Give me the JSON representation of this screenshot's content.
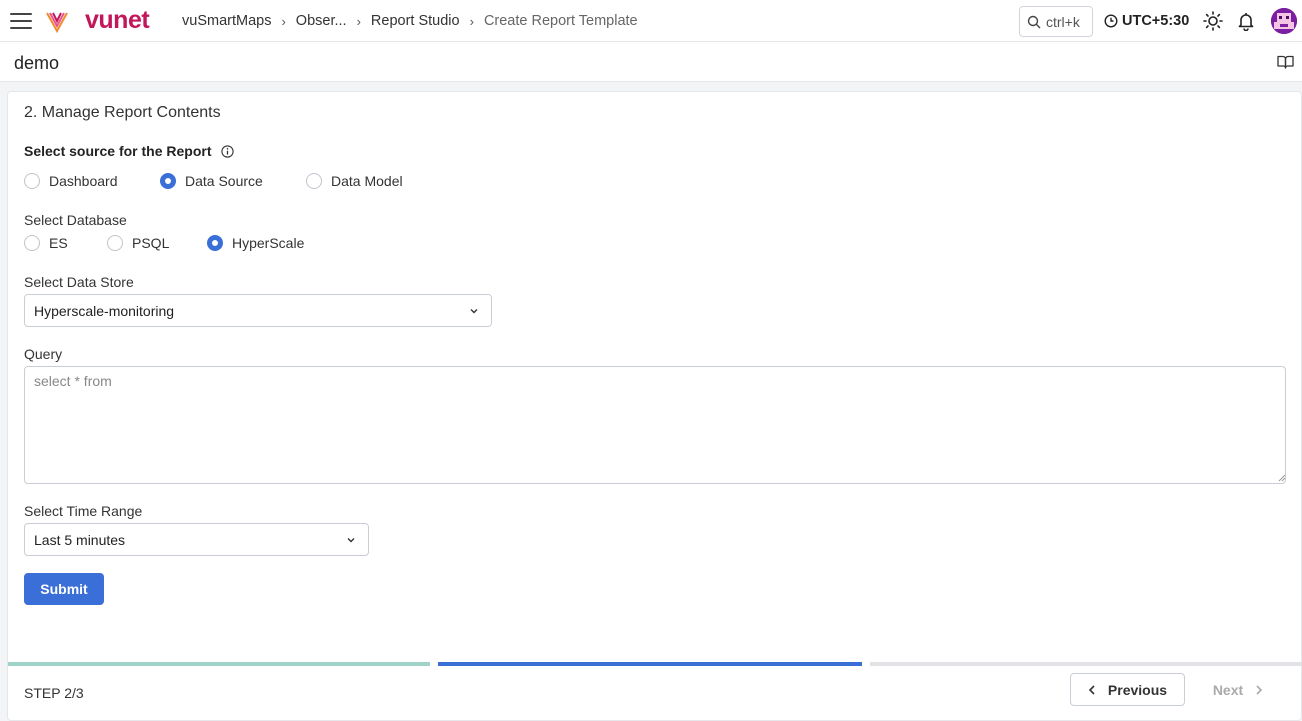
{
  "header": {
    "logo_text": "vunet",
    "breadcrumbs": [
      "vuSmartMaps",
      "Obser...",
      "Report Studio",
      "Create Report Template"
    ],
    "search_shortcut": "ctrl+k",
    "timezone": "UTC+5:30",
    "icons": [
      "menu-icon",
      "vunet-logo",
      "search-icon",
      "clock-icon",
      "sun-icon",
      "bell-icon",
      "avatar"
    ]
  },
  "subheader": {
    "title": "demo",
    "icon": "book-icon"
  },
  "form": {
    "section_title": "2. Manage Report Contents",
    "source_label": "Select source for the Report",
    "source_options": [
      "Dashboard",
      "Data Source",
      "Data Model"
    ],
    "source_selected": "Data Source",
    "database_label": "Select Database",
    "database_options": [
      "ES",
      "PSQL",
      "HyperScale"
    ],
    "database_selected": "HyperScale",
    "datastore_label": "Select Data Store",
    "datastore_value": "Hyperscale-monitoring",
    "query_label": "Query",
    "query_value": "",
    "query_placeholder": "select * from",
    "timerange_label": "Select Time Range",
    "timerange_value": "Last 5 minutes",
    "submit_label": "Submit"
  },
  "footer": {
    "step_text": "STEP 2/3",
    "previous_label": "Previous",
    "next_label": "Next",
    "next_enabled": false,
    "progress": [
      {
        "state": "done",
        "color": "#9fd3c7"
      },
      {
        "state": "current",
        "color": "#3a6fd8"
      },
      {
        "state": "pending",
        "color": "#e1e3e6"
      }
    ]
  },
  "colors": {
    "primary": "#3a6fd8",
    "brand": "#c2185b"
  }
}
